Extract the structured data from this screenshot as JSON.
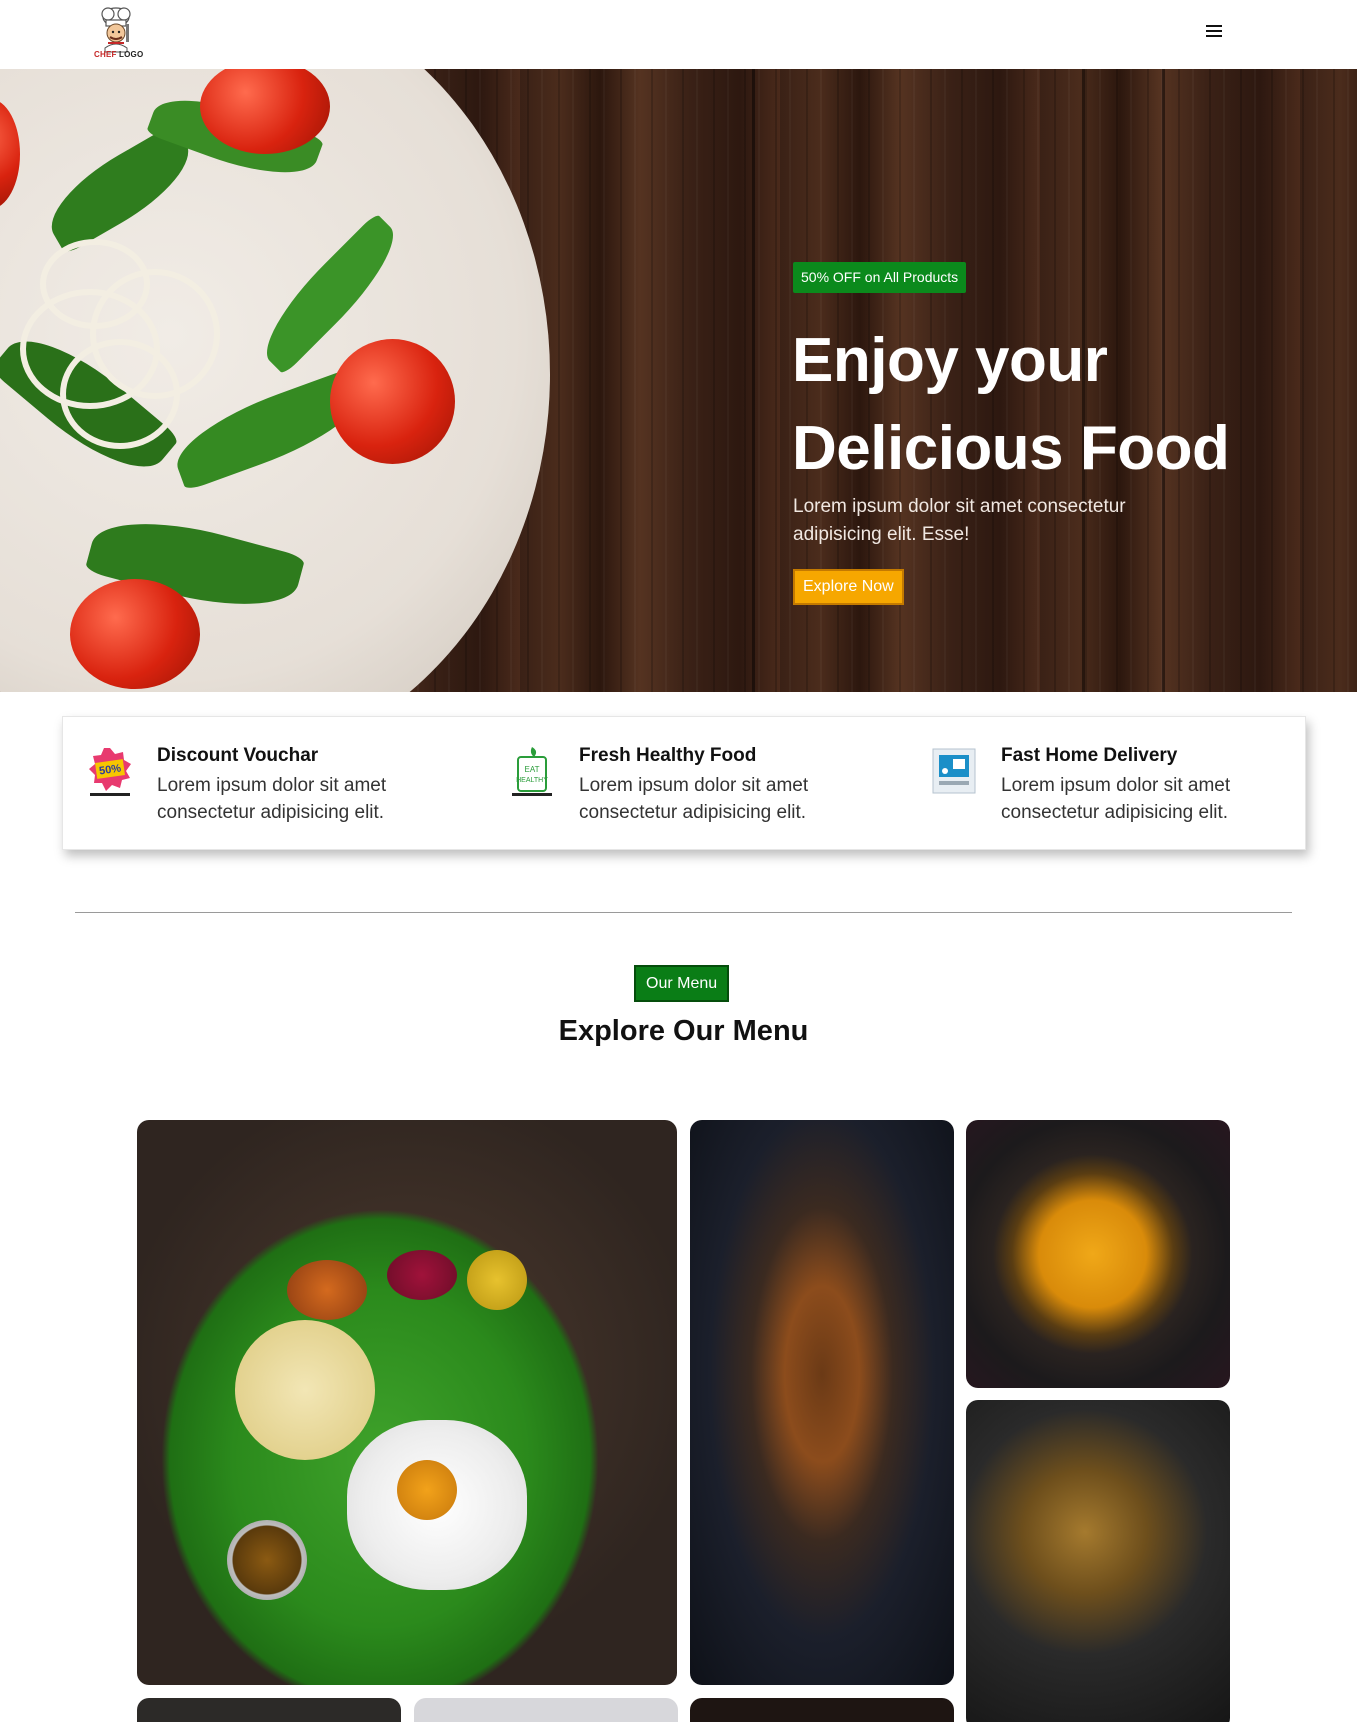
{
  "header": {
    "logo_text_a": "CHEF",
    "logo_text_b": "LOGO",
    "menu_icon": "hamburger-menu-icon"
  },
  "hero": {
    "offer_badge": "50% OFF on All Products",
    "title_line1": "Enjoy your",
    "title_line2": "Delicious Food",
    "description": "Lorem ipsum dolor sit amet consectetur adipisicing elit. Esse!",
    "cta": "Explore Now"
  },
  "features": [
    {
      "title": "Discount Vouchar",
      "description": "Lorem ipsum dolor sit amet consectetur adipisicing elit.",
      "icon": "discount-badge-icon"
    },
    {
      "title": "Fresh Healthy Food",
      "description": "Lorem ipsum dolor sit amet consectetur adipisicing elit.",
      "icon": "eat-healthy-icon"
    },
    {
      "title": "Fast Home Delivery",
      "description": "Lorem ipsum dolor sit amet consectetur adipisicing elit.",
      "icon": "home-delivery-icon"
    }
  ],
  "menu_section": {
    "badge": "Our Menu",
    "title": "Explore Our Menu"
  },
  "colors": {
    "offer_green": "#0b8a1c",
    "cta_orange": "#f6a700",
    "menu_badge_green": "#0a7d16"
  }
}
